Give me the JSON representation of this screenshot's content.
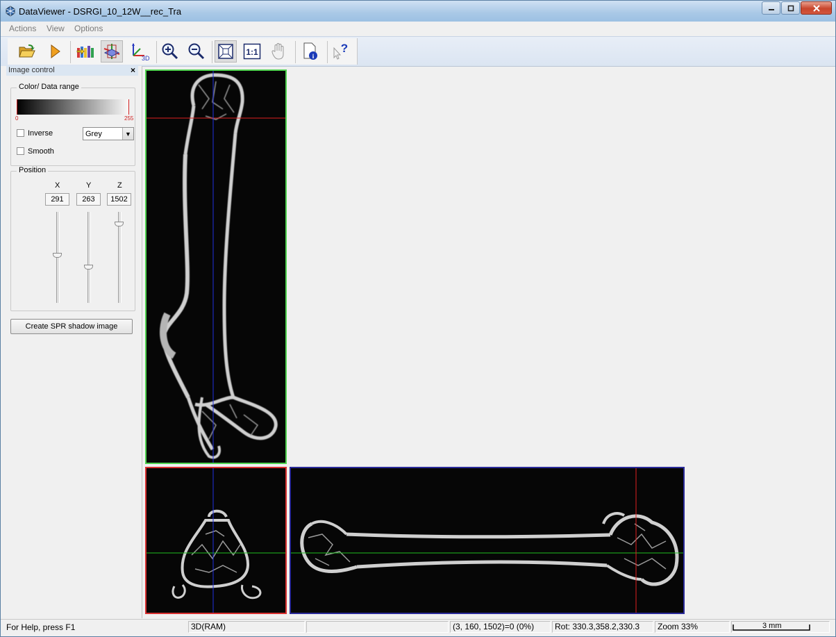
{
  "window": {
    "title": "DataViewer - DSRGI_10_12W__rec_Tra"
  },
  "menu": [
    "Actions",
    "View",
    "Options"
  ],
  "toolbar": {
    "buttons": [
      {
        "name": "open-folder-icon"
      },
      {
        "name": "play-icon"
      },
      {
        "name": "dataset-colors-icon"
      },
      {
        "name": "tri-plane-icon",
        "pressed": true
      },
      {
        "name": "axes-3d-icon"
      },
      {
        "name": "zoom-in-icon"
      },
      {
        "name": "zoom-out-icon"
      },
      {
        "name": "fit-to-window-icon",
        "pressed": true
      },
      {
        "name": "actual-size-icon",
        "label": "1:1"
      },
      {
        "name": "pan-hand-icon"
      },
      {
        "name": "info-document-icon"
      },
      {
        "name": "context-help-icon"
      }
    ]
  },
  "image_control": {
    "title": "Image control",
    "close_glyph": "×",
    "color_range": {
      "title": "Color/ Data range",
      "min_label": "0",
      "max_label": "255",
      "inverse_label": "Inverse",
      "smooth_label": "Smooth",
      "palette": "Grey",
      "inverse_checked": false,
      "smooth_checked": false
    },
    "position": {
      "title": "Position",
      "x_label": "X",
      "y_label": "Y",
      "z_label": "Z",
      "x": "291",
      "y": "263",
      "z": "1502",
      "x_level": 0.53,
      "y_level": 0.4,
      "z_level": 0.87
    },
    "spr_button": "Create SPR shadow image"
  },
  "views": {
    "coronal_border": "#4fd24f",
    "transaxial_border": "#d83030",
    "sagittal_border": "#2b2b9a",
    "crosshair_red": "#e02020",
    "crosshair_green": "#20c020",
    "crosshair_blue": "#2030e0"
  },
  "status": {
    "help": "For Help, press F1",
    "mode": "3D(RAM)",
    "empty": "",
    "coords": "(3, 160, 1502)=0 (0%)",
    "rotation": "Rot: 330.3,358.2,330.3",
    "zoom": "Zoom 33%",
    "scale": "3 mm"
  }
}
